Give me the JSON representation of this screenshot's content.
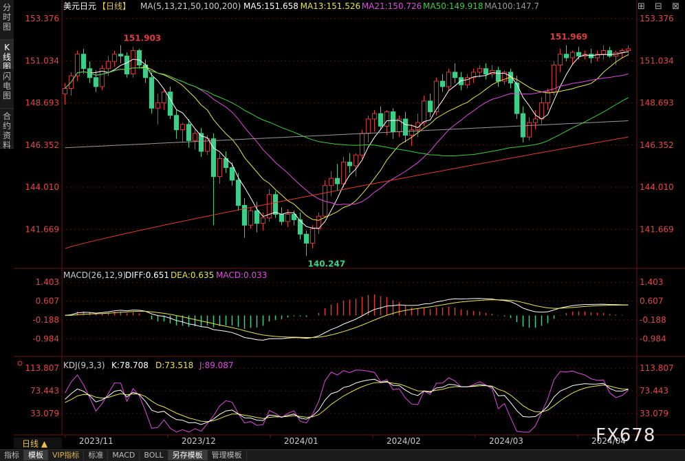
{
  "sidebar": {
    "tabs": [
      {
        "label": "分时图",
        "active": false
      },
      {
        "label": "K线图",
        "active": true
      },
      {
        "label": "闪电图",
        "active": false
      },
      {
        "label": "合约资料",
        "active": false
      }
    ]
  },
  "header": {
    "instrument": "美元日元",
    "period_tag": "【日线】",
    "ma_label": "MA(5,13,21,50,100,200)",
    "ma_items": [
      {
        "label": "MA5:151.658",
        "color": "#ffffff"
      },
      {
        "label": "MA13:151.526",
        "color": "#e6e64a"
      },
      {
        "label": "MA21:150.726",
        "color": "#e04ae0"
      },
      {
        "label": "MA50:149.918",
        "color": "#3ad03a"
      },
      {
        "label": "MA100:147.7",
        "color": "#9a9a9a"
      }
    ]
  },
  "top_icons": [
    "square-icon",
    "restore-icon",
    "close-icon"
  ],
  "colors": {
    "up": "#e03c3c",
    "down": "#3ad08a",
    "axis_text": "#e04848",
    "grid": "#5a1010",
    "ma5": "#ffffff",
    "ma13": "#e6e64a",
    "ma21": "#e04ae0",
    "ma50": "#3ad03a",
    "ma100": "#9a9a9a",
    "ma200": "#e03c2a"
  },
  "price_axis": {
    "ticks": [
      "153.376",
      "151.034",
      "148.693",
      "146.352",
      "144.010",
      "141.669"
    ]
  },
  "annotations": {
    "high1": "151.903",
    "high2": "151.969",
    "low": "140.247"
  },
  "macd_panel": {
    "title": "MACD(26,12,9)",
    "diff": "DIFF:0.651",
    "dea": "DEA:0.635",
    "macd": "MACD:0.033",
    "ticks": [
      "1.403",
      "0.607",
      "-0.188",
      "-0.984"
    ]
  },
  "kdj_panel": {
    "title": "KDJ(9,3,3)",
    "k": "K:78.708",
    "d": "D:73.518",
    "j": "J:89.087",
    "ticks": [
      "113.807",
      "73.443",
      "33.079"
    ]
  },
  "x_axis": {
    "labels": [
      "2023/11",
      "2023/12",
      "2024/01",
      "2024/02",
      "2024/03",
      "2024/04"
    ]
  },
  "period_label": "日线 ▲",
  "bottom_tabs": [
    {
      "label": "指标",
      "active": false,
      "vip": false
    },
    {
      "label": "模板",
      "active": true,
      "vip": false
    },
    {
      "label": "VIP指标",
      "active": false,
      "vip": true
    },
    {
      "label": "标准",
      "active": false,
      "vip": false
    },
    {
      "label": "MACD",
      "active": false,
      "vip": false
    },
    {
      "label": "BOLL",
      "active": false,
      "vip": false
    },
    {
      "label": "另存模板",
      "active": true,
      "vip": false
    },
    {
      "label": "管理模板",
      "active": false,
      "vip": false
    }
  ],
  "watermark": "FX678",
  "chart_data": {
    "type": "candlestick",
    "title": "美元日元【日线】",
    "ylim": [
      139.5,
      153.8
    ],
    "candles": [
      [
        149.2,
        149.8,
        148.6,
        149.5
      ],
      [
        149.5,
        150.4,
        149.1,
        150.2
      ],
      [
        150.2,
        151.6,
        149.9,
        151.4
      ],
      [
        151.4,
        151.7,
        150.3,
        150.6
      ],
      [
        150.6,
        151.0,
        149.8,
        150.1
      ],
      [
        150.1,
        150.5,
        149.3,
        149.6
      ],
      [
        149.6,
        150.8,
        149.4,
        150.6
      ],
      [
        150.6,
        151.3,
        150.2,
        151.0
      ],
      [
        151.0,
        151.6,
        150.7,
        151.4
      ],
      [
        151.4,
        151.9,
        150.9,
        151.3
      ],
      [
        151.3,
        151.5,
        150.1,
        150.3
      ],
      [
        150.3,
        151.8,
        150.1,
        151.6
      ],
      [
        151.6,
        151.7,
        150.6,
        150.8
      ],
      [
        150.8,
        151.1,
        149.8,
        150.1
      ],
      [
        150.1,
        150.4,
        148.1,
        148.4
      ],
      [
        148.4,
        149.2,
        147.5,
        148.7
      ],
      [
        148.7,
        149.5,
        148.3,
        149.3
      ],
      [
        149.3,
        149.6,
        147.8,
        148.0
      ],
      [
        148.0,
        148.3,
        146.7,
        147.2
      ],
      [
        147.2,
        147.6,
        146.5,
        147.5
      ],
      [
        147.5,
        147.8,
        146.2,
        146.6
      ],
      [
        146.6,
        147.2,
        146.1,
        147.0
      ],
      [
        147.0,
        147.3,
        145.7,
        146.0
      ],
      [
        146.0,
        146.9,
        145.8,
        146.7
      ],
      [
        146.7,
        147.0,
        141.9,
        144.6
      ],
      [
        144.6,
        145.9,
        144.2,
        145.6
      ],
      [
        145.6,
        146.0,
        144.8,
        145.1
      ],
      [
        145.1,
        145.4,
        144.1,
        144.4
      ],
      [
        144.4,
        144.8,
        142.7,
        143.0
      ],
      [
        143.0,
        143.4,
        141.2,
        141.9
      ],
      [
        141.9,
        142.9,
        141.7,
        142.7
      ],
      [
        142.7,
        143.2,
        141.5,
        142.0
      ],
      [
        142.0,
        142.6,
        141.6,
        142.3
      ],
      [
        142.3,
        143.9,
        142.1,
        143.6
      ],
      [
        143.6,
        143.8,
        142.3,
        142.5
      ],
      [
        142.5,
        142.9,
        141.9,
        142.1
      ],
      [
        142.1,
        142.8,
        141.8,
        142.5
      ],
      [
        142.5,
        142.7,
        141.9,
        142.2
      ],
      [
        142.2,
        142.6,
        141.1,
        141.4
      ],
      [
        141.4,
        141.6,
        140.2,
        140.9
      ],
      [
        140.9,
        141.9,
        140.6,
        141.7
      ],
      [
        141.7,
        142.6,
        141.4,
        142.4
      ],
      [
        142.4,
        144.4,
        142.3,
        144.1
      ],
      [
        144.1,
        144.9,
        143.5,
        144.5
      ],
      [
        144.5,
        145.3,
        143.8,
        144.2
      ],
      [
        144.2,
        145.7,
        144.0,
        145.4
      ],
      [
        145.4,
        145.9,
        144.8,
        145.2
      ],
      [
        145.2,
        145.9,
        144.6,
        145.8
      ],
      [
        145.8,
        147.2,
        145.6,
        147.0
      ],
      [
        147.0,
        148.0,
        146.5,
        147.8
      ],
      [
        147.8,
        148.3,
        147.1,
        148.1
      ],
      [
        148.1,
        148.5,
        147.2,
        147.4
      ],
      [
        147.4,
        148.3,
        146.9,
        148.2
      ],
      [
        148.2,
        148.4,
        146.7,
        147.1
      ],
      [
        147.1,
        148.0,
        146.8,
        147.8
      ],
      [
        147.8,
        148.2,
        146.5,
        146.9
      ],
      [
        146.9,
        147.5,
        146.3,
        147.2
      ],
      [
        147.2,
        148.1,
        146.8,
        147.6
      ],
      [
        147.6,
        149.1,
        147.4,
        148.8
      ],
      [
        148.8,
        149.2,
        147.9,
        148.2
      ],
      [
        148.2,
        150.1,
        148.0,
        149.9
      ],
      [
        149.9,
        150.3,
        149.3,
        149.6
      ],
      [
        149.6,
        150.6,
        149.4,
        150.4
      ],
      [
        150.4,
        150.9,
        149.8,
        150.1
      ],
      [
        150.1,
        150.4,
        149.4,
        149.7
      ],
      [
        149.7,
        150.3,
        149.5,
        150.1
      ],
      [
        150.1,
        150.6,
        149.8,
        150.4
      ],
      [
        150.4,
        150.8,
        150.1,
        150.6
      ],
      [
        150.6,
        150.9,
        150.0,
        150.3
      ],
      [
        150.3,
        150.8,
        150.1,
        150.5
      ],
      [
        150.5,
        150.7,
        149.6,
        149.9
      ],
      [
        149.9,
        150.5,
        149.7,
        150.4
      ],
      [
        150.4,
        150.6,
        149.5,
        149.8
      ],
      [
        149.8,
        150.2,
        147.8,
        148.1
      ],
      [
        148.1,
        148.5,
        146.5,
        146.8
      ],
      [
        146.8,
        147.9,
        146.6,
        147.6
      ],
      [
        147.6,
        148.3,
        147.2,
        147.8
      ],
      [
        147.8,
        149.0,
        147.5,
        148.7
      ],
      [
        148.7,
        149.5,
        148.3,
        149.3
      ],
      [
        149.3,
        151.0,
        149.1,
        150.8
      ],
      [
        150.8,
        151.7,
        150.4,
        151.4
      ],
      [
        151.4,
        151.9,
        151.0,
        151.2
      ],
      [
        151.2,
        151.6,
        150.8,
        151.5
      ],
      [
        151.5,
        151.8,
        151.1,
        151.3
      ],
      [
        151.3,
        151.6,
        151.1,
        151.4
      ],
      [
        151.4,
        151.7,
        150.9,
        151.2
      ],
      [
        151.2,
        151.6,
        151.0,
        151.4
      ],
      [
        151.4,
        151.9,
        151.1,
        151.6
      ],
      [
        151.6,
        151.8,
        151.2,
        151.3
      ],
      [
        151.3,
        151.6,
        150.8,
        151.5
      ],
      [
        151.5,
        151.7,
        151.2,
        151.6
      ],
      [
        151.6,
        151.9,
        151.3,
        151.7
      ]
    ],
    "macd_ylim": [
      -1.5,
      1.7
    ],
    "kdj_ylim": [
      0,
      125
    ]
  }
}
